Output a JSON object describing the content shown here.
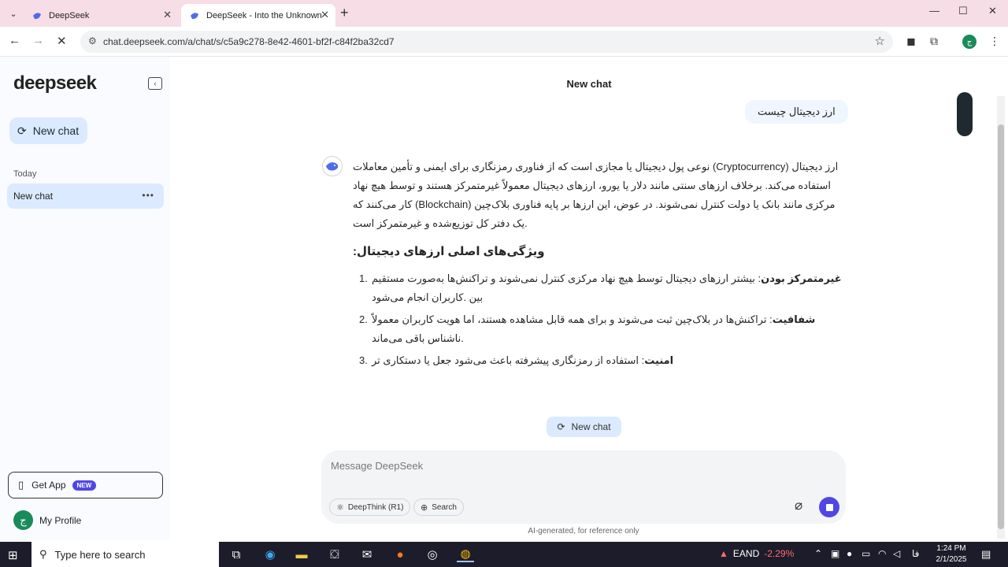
{
  "browser": {
    "tabs": [
      {
        "title": "DeepSeek"
      },
      {
        "title": "DeepSeek - Into the Unknown"
      }
    ],
    "url": "chat.deepseek.com/a/chat/s/c5a9c278-8e42-4601-bf2f-c84f2ba32cd7",
    "profile_initial": "ج"
  },
  "sidebar": {
    "logo": "deepseek",
    "new_chat_label": "New chat",
    "section_today": "Today",
    "chats": [
      {
        "title": "New chat"
      }
    ],
    "get_app_label": "Get App",
    "new_badge": "NEW",
    "profile_label": "My Profile",
    "profile_initial": "ج"
  },
  "main": {
    "title": "New chat",
    "user_message": "ارز دیجیتال چیست",
    "answer": {
      "intro": "نوعی پول دیجیتال یا مجازی است که از فناوری رمزنگاری برای ایمنی و تأمین معاملات (Cryptocurrency) ارز دیجیتال استفاده می‌کند. برخلاف ارزهای سنتی مانند دلار یا یورو، ارزهای دیجیتال معمولاً غیرمتمرکز هستند و توسط هیچ نهاد کار می‌کنند که (Blockchain) مرکزی مانند بانک یا دولت کنترل نمی‌شوند. در عوض، این ارزها بر پایه فناوری بلاک‌چین .یک دفتر کل توزیع‌شده و غیرمتمرکز است",
      "heading": ":ویژگی‌های اصلی ارزهای دیجیتال",
      "items": [
        {
          "num": "1.",
          "bold": "غیرمتمرکز بودن",
          "text": ": بیشتر ارزهای دیجیتال توسط هیچ نهاد مرکزی کنترل نمی‌شوند و تراکنش‌ها به‌صورت مستقیم بین .کاربران انجام می‌شود"
        },
        {
          "num": "2.",
          "bold": "شفافیت",
          "text": ": تراکنش‌ها در بلاک‌چین ثبت می‌شوند و برای همه قابل مشاهده هستند، اما هویت کاربران معمولاً .ناشناس باقی می‌ماند"
        },
        {
          "num": "3.",
          "bold": "امنیت",
          "text": ": استفاده از رمزنگاری پیشرفته باعث می‌شود جعل یا دستکاری تر"
        }
      ]
    },
    "new_chat_pill": "New chat"
  },
  "composer": {
    "placeholder": "Message DeepSeek",
    "deepthink_label": "DeepThink (R1)",
    "search_label": "Search",
    "disclaimer": "AI-generated, for reference only"
  },
  "taskbar": {
    "search_placeholder": "Type here to search",
    "stock_name": "EAND",
    "stock_change": "-2.29%",
    "lang": "فا",
    "time": "1:24 PM",
    "date": "2/1/2025"
  },
  "colors": {
    "accent": "#4f46e5",
    "selected": "#dbeafe",
    "tabbar": "#f6dde6"
  }
}
